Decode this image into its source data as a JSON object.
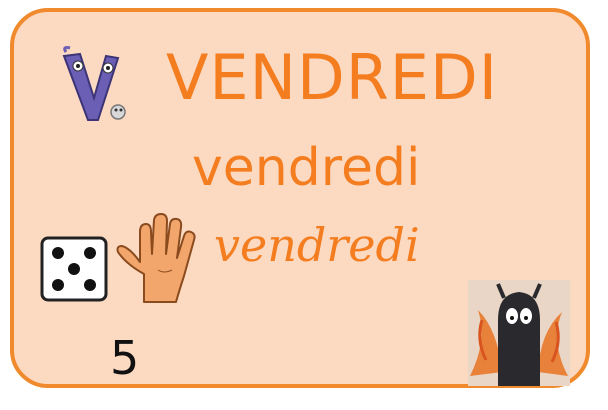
{
  "card": {
    "title_upper": "VENDREDI",
    "title_lower": "vendredi",
    "title_cursive": "vendredi",
    "number": "5"
  },
  "colors": {
    "border": "#f08a2c",
    "background": "#fcd9c1",
    "text": "#f47d20"
  },
  "icons": {
    "letter_logo": "letter-v-character-icon",
    "die": "die-five-icon",
    "hand": "hand-five-fingers-icon",
    "monster": "monster-picture"
  }
}
